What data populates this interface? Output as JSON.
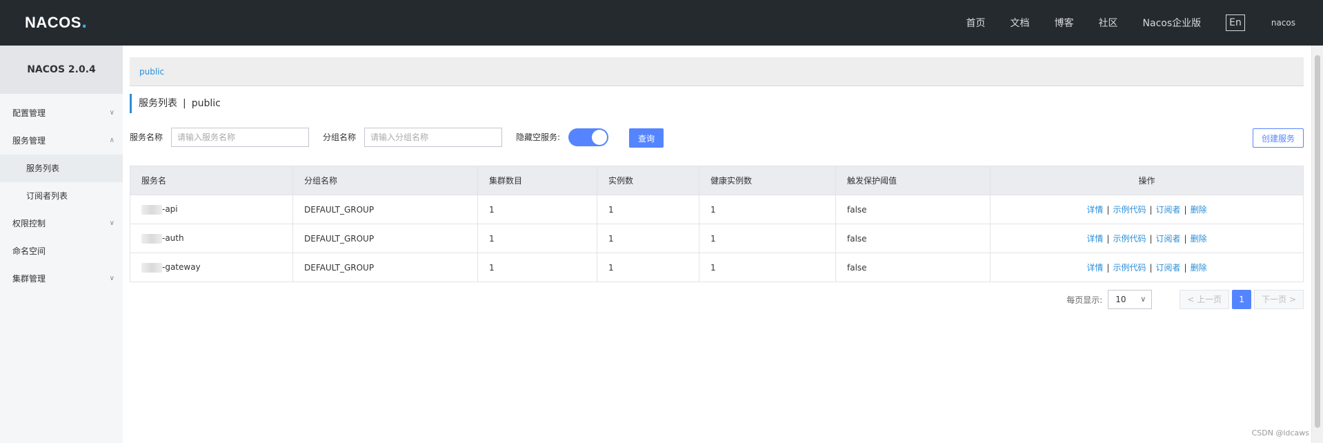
{
  "header": {
    "logo_text": "NACOS",
    "logo_dot": ".",
    "nav": [
      "首页",
      "文档",
      "博客",
      "社区",
      "Nacos企业版"
    ],
    "lang": "En",
    "user": "nacos"
  },
  "sidebar": {
    "version": "NACOS 2.0.4",
    "items": [
      {
        "label": "配置管理",
        "chevron": "∨"
      },
      {
        "label": "服务管理",
        "chevron": "∧"
      },
      {
        "label": "服务列表"
      },
      {
        "label": "订阅者列表"
      },
      {
        "label": "权限控制",
        "chevron": "∨"
      },
      {
        "label": "命名空间"
      },
      {
        "label": "集群管理",
        "chevron": "∨"
      }
    ]
  },
  "breadcrumb": "public",
  "title": {
    "main": "服务列表",
    "sep": "|",
    "namespace": "public"
  },
  "filters": {
    "service_label": "服务名称",
    "service_placeholder": "请输入服务名称",
    "group_label": "分组名称",
    "group_placeholder": "请输入分组名称",
    "hide_empty_label": "隐藏空服务:",
    "query_button": "查询",
    "create_button": "创建服务"
  },
  "table": {
    "headers": [
      "服务名",
      "分组名称",
      "集群数目",
      "实例数",
      "健康实例数",
      "触发保护阈值",
      "操作"
    ],
    "rows": [
      {
        "name": "-api",
        "group": "DEFAULT_GROUP",
        "clusters": "1",
        "instances": "1",
        "healthy": "1",
        "threshold": "false"
      },
      {
        "name": "-auth",
        "group": "DEFAULT_GROUP",
        "clusters": "1",
        "instances": "1",
        "healthy": "1",
        "threshold": "false"
      },
      {
        "name": "-gateway",
        "group": "DEFAULT_GROUP",
        "clusters": "1",
        "instances": "1",
        "healthy": "1",
        "threshold": "false"
      }
    ],
    "ops": [
      "详情",
      "示例代码",
      "订阅者",
      "删除"
    ],
    "op_sep": "|"
  },
  "pagination": {
    "page_size_label": "每页显示:",
    "page_size": "10",
    "prev": "< 上一页",
    "current": "1",
    "next": "下一页 >"
  },
  "watermark": "CSDN @ldcaws",
  "colors": {
    "accent": "#5584ff",
    "link": "#2a8ed8",
    "topbar": "#252a2f"
  }
}
